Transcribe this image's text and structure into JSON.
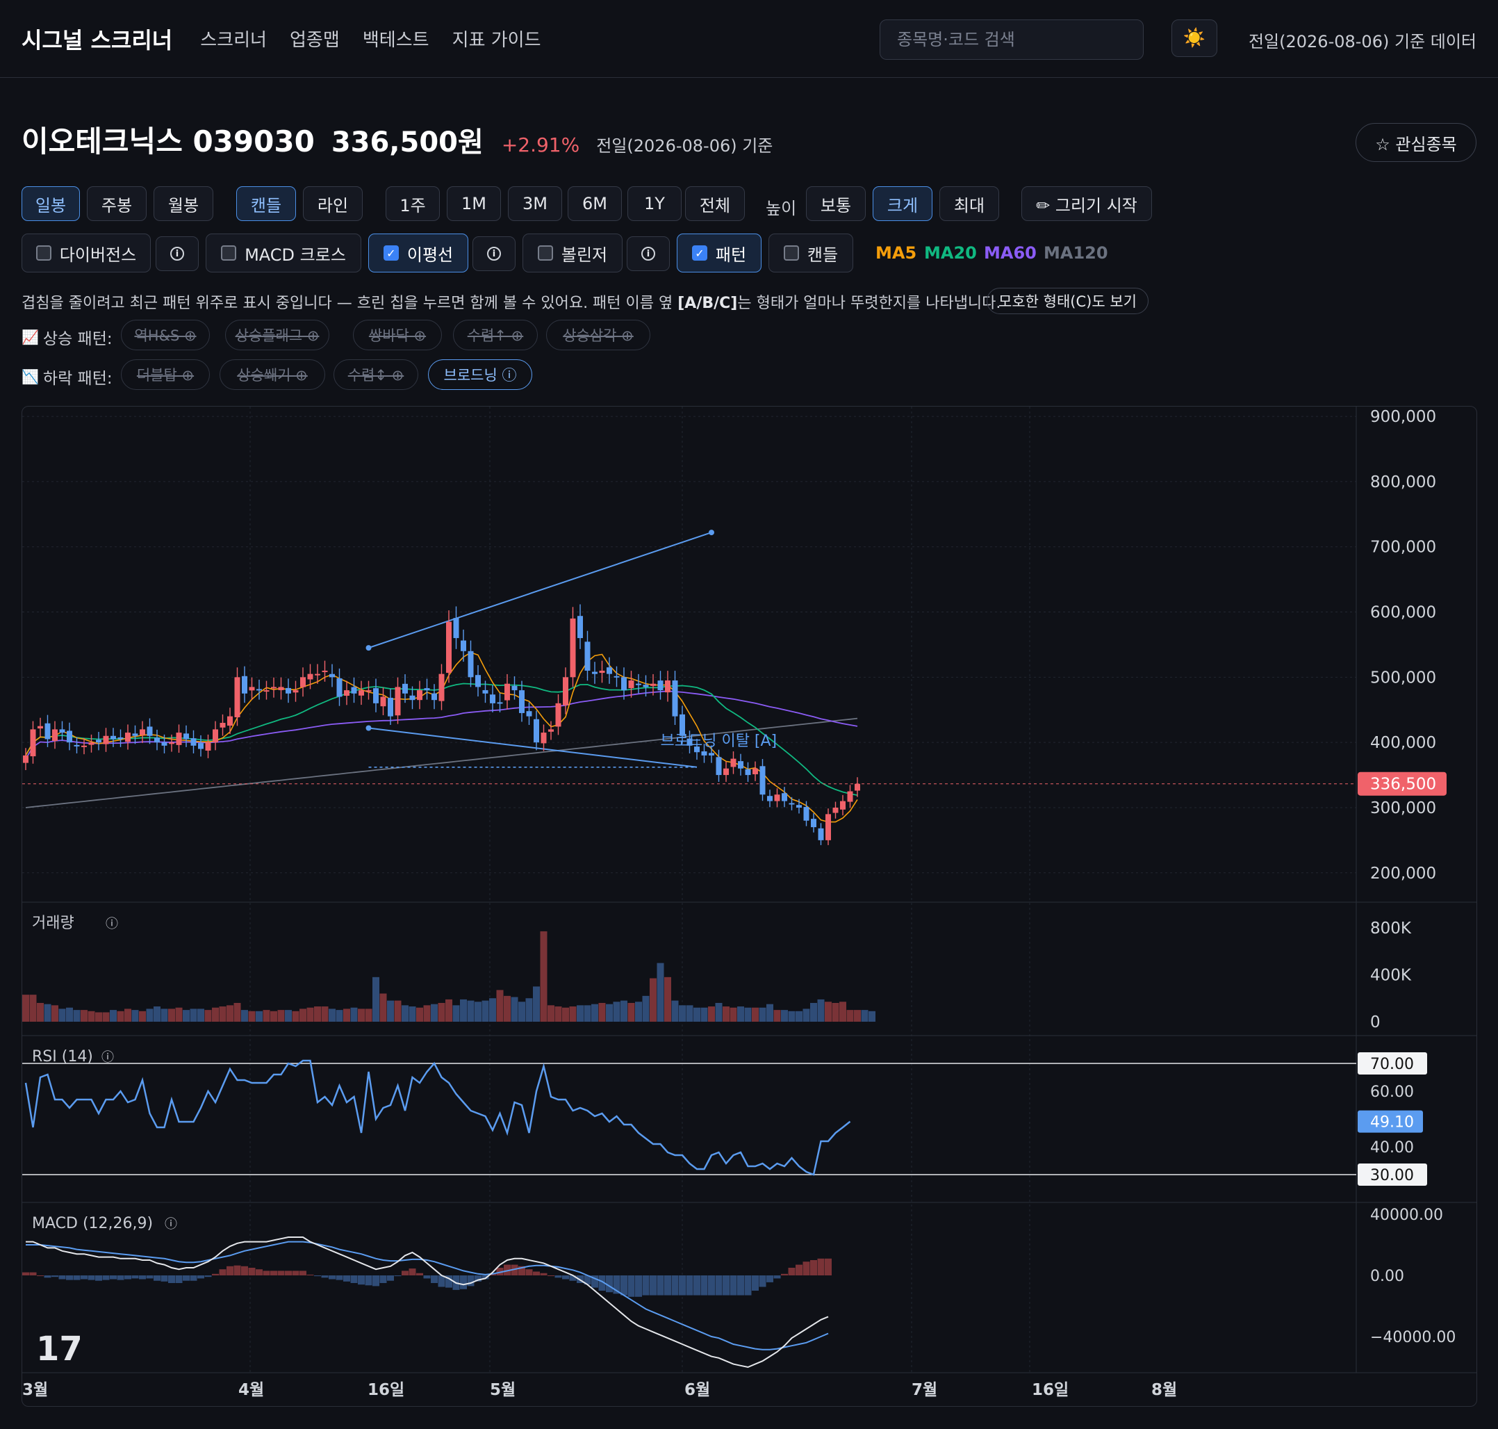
{
  "header": {
    "brand": "시그널 스크리너",
    "nav": [
      "스크리너",
      "업종맵",
      "백테스트",
      "지표 가이드"
    ],
    "search_placeholder": "종목명·코드 검색",
    "theme_icon": "☀️",
    "data_basis": "전일(2026-08-06) 기준 데이터"
  },
  "stock": {
    "name_code": "이오테크닉스 039030",
    "price": "336,500원",
    "change": "+2.91%",
    "basis": "전일(2026-08-06) 기준",
    "watch_label": "☆ 관심종목"
  },
  "controls": {
    "period": [
      "일봉",
      "주봉",
      "월봉"
    ],
    "chart_type": [
      "캔들",
      "라인"
    ],
    "range": [
      "1주",
      "1M",
      "3M",
      "6M",
      "1Y",
      "전체"
    ],
    "height_label": "높이",
    "height": [
      "보통",
      "크게",
      "최대"
    ],
    "draw_label": "✏ 그리기 시작",
    "indicators": {
      "divergence": "다이버전스",
      "macd_cross": "MACD 크로스",
      "ma_lines": "이평선",
      "bollinger": "볼린저",
      "pattern": "패턴",
      "candle": "캔들"
    },
    "ma_legend": [
      {
        "label": "MA5",
        "color": "#f59e0b"
      },
      {
        "label": "MA20",
        "color": "#10b981"
      },
      {
        "label": "MA60",
        "color": "#8b5cf6"
      },
      {
        "label": "MA120",
        "color": "#6b7280"
      }
    ]
  },
  "pattern_note": {
    "text1": "겹침을 줄이려고 최근 패턴 위주로 표시 중입니다 — 흐린 칩을 누르면 함께 볼 수 있어요. 패턴 이름 옆 ",
    "bold": "[A/B/C]",
    "text2": "는 형태가 얼마나 뚜렷한지를 나타냅니다.",
    "ambiguous_btn": "모호한 형태(C)도 보기"
  },
  "patterns": {
    "up_label": "상승 패턴:",
    "up_icon": "📈",
    "up": [
      "역H&S ⊕",
      "상승플래그 ⊕",
      "쌍바닥 ⊕",
      "수렴↑ ⊕",
      "상승삼각 ⊕"
    ],
    "down_label": "하락 패턴:",
    "down_icon": "📉",
    "down": [
      "더블탑 ⊕",
      "상승쐐기 ⊕",
      "수렴↕ ⊕",
      "브로드닝 ⓘ"
    ]
  },
  "chart_data": {
    "type": "candlestick",
    "price_axis": [
      "900,000",
      "800,000",
      "700,000",
      "600,000",
      "500,000",
      "400,000",
      "300,000",
      "200,000"
    ],
    "price_ylim": [
      155000,
      915000
    ],
    "last_price_label": "336,500",
    "last_price": 336500,
    "pattern_annotation": "브로드닝 이탈 [A]",
    "volume_title": "거래량",
    "volume_axis": [
      "800K",
      "400K",
      "0"
    ],
    "rsi_title": "RSI (14)",
    "rsi_axis": [
      "70.00",
      "60.00",
      "49.10",
      "40.00",
      "30.00"
    ],
    "rsi_last": 49.1,
    "macd_title": "MACD (12,26,9)",
    "macd_axis": [
      "40000.00",
      "0.00",
      "−40000.00"
    ],
    "x_labels": [
      "3월",
      "4월",
      "16일",
      "5월",
      "6월",
      "7월",
      "16일",
      "8월"
    ],
    "watermark": "17",
    "closes": [
      380000,
      420000,
      425000,
      405000,
      420000,
      415000,
      400000,
      395000,
      395000,
      400000,
      400000,
      410000,
      405000,
      405000,
      415000,
      410000,
      420000,
      410000,
      400000,
      395000,
      400000,
      415000,
      405000,
      395000,
      390000,
      400000,
      420000,
      430000,
      440000,
      500000,
      475000,
      485000,
      480000,
      480000,
      485000,
      485000,
      475000,
      480000,
      500000,
      505000,
      505000,
      510000,
      500000,
      470000,
      480000,
      475000,
      480000,
      480000,
      460000,
      470000,
      440000,
      485000,
      475000,
      465000,
      480000,
      480000,
      465000,
      505000,
      585000,
      560000,
      540000,
      500000,
      485000,
      475000,
      460000,
      460000,
      490000,
      480000,
      445000,
      440000,
      400000,
      415000,
      420000,
      460000,
      500000,
      590000,
      560000,
      510000,
      505000,
      510000,
      505000,
      500000,
      480000,
      495000,
      490000,
      485000,
      490000,
      480000,
      495000,
      440000,
      410000,
      395000,
      385000,
      380000,
      380000,
      350000,
      360000,
      375000,
      360000,
      350000,
      360000,
      320000,
      310000,
      320000,
      310000,
      305000,
      300000,
      280000,
      270000,
      250000,
      290000,
      300000,
      310000,
      325000,
      336500
    ],
    "volumes": [
      230,
      230,
      160,
      150,
      140,
      110,
      120,
      100,
      100,
      90,
      80,
      80,
      100,
      90,
      110,
      100,
      90,
      110,
      130,
      110,
      110,
      120,
      100,
      110,
      110,
      100,
      120,
      130,
      140,
      160,
      100,
      90,
      90,
      100,
      90,
      100,
      100,
      90,
      110,
      120,
      130,
      130,
      110,
      100,
      110,
      120,
      110,
      110,
      380,
      240,
      180,
      180,
      140,
      130,
      120,
      140,
      150,
      160,
      190,
      140,
      190,
      180,
      170,
      180,
      200,
      270,
      220,
      210,
      170,
      200,
      300,
      770,
      140,
      130,
      120,
      130,
      140,
      140,
      150,
      160,
      150,
      170,
      180,
      160,
      170,
      220,
      370,
      500,
      380,
      180,
      140,
      140,
      120,
      120,
      130,
      160,
      130,
      120,
      130,
      120,
      120,
      120,
      150,
      100,
      100,
      90,
      90,
      110,
      160,
      190,
      170,
      160,
      170,
      100,
      100,
      100,
      90
    ],
    "rsi": [
      63,
      47,
      65,
      66,
      57,
      57,
      54,
      57,
      57,
      57,
      52,
      57,
      57,
      60,
      56,
      57,
      64,
      52,
      47,
      47,
      57,
      49,
      49,
      49,
      54,
      60,
      56,
      62,
      68,
      64,
      64,
      63,
      63,
      63,
      66,
      66,
      70,
      69,
      71,
      71,
      56,
      58,
      55,
      62,
      56,
      58,
      45,
      67,
      50,
      54,
      55,
      62,
      53,
      65,
      63,
      67,
      70,
      65,
      63,
      59,
      56,
      53,
      52,
      51,
      46,
      52,
      45,
      56,
      55,
      45,
      60,
      69,
      58,
      57,
      57,
      53,
      54,
      53,
      51,
      52,
      49,
      51,
      48,
      48,
      45,
      43,
      41,
      41,
      38,
      37,
      37,
      34,
      32,
      32,
      37,
      38,
      34,
      37,
      38,
      33,
      33,
      34,
      32,
      34,
      33,
      36,
      33,
      31,
      30,
      42,
      42,
      45,
      47,
      49.1
    ],
    "macd": [
      22000,
      22000,
      20000,
      18000,
      18000,
      16000,
      15000,
      14000,
      14000,
      13000,
      12000,
      12000,
      12000,
      11000,
      11000,
      11000,
      10000,
      10000,
      8000,
      7000,
      5000,
      4000,
      5000,
      5000,
      7000,
      9000,
      12000,
      16000,
      19000,
      21000,
      22000,
      22000,
      22000,
      22000,
      23000,
      24000,
      25000,
      25000,
      25000,
      22000,
      20000,
      18000,
      16000,
      14000,
      12000,
      10000,
      8000,
      6000,
      4000,
      5000,
      6000,
      9000,
      13000,
      15000,
      12000,
      8000,
      4000,
      0,
      -2000,
      -5000,
      -6000,
      -5000,
      -3000,
      -2000,
      2000,
      7000,
      10000,
      11000,
      11000,
      10000,
      9000,
      8000,
      6000,
      4000,
      2000,
      0,
      -3000,
      -6000,
      -10000,
      -14000,
      -18000,
      -22000,
      -26000,
      -30000,
      -33000,
      -35000,
      -37000,
      -39000,
      -41000,
      -43000,
      -45000,
      -47000,
      -49000,
      -51000,
      -53000,
      -54000,
      -56000,
      -58000,
      -59000,
      -60000,
      -58000,
      -56000,
      -53000,
      -50000,
      -46000,
      -41000,
      -38000,
      -35000,
      -32000,
      -29000,
      -27000
    ],
    "signal": [
      20000,
      20000,
      20000,
      19500,
      19000,
      18500,
      18000,
      17000,
      16500,
      16000,
      15500,
      15000,
      14500,
      14000,
      13500,
      13000,
      12500,
      12000,
      11500,
      11000,
      10000,
      9000,
      8500,
      8500,
      9000,
      10000,
      11000,
      12000,
      13000,
      14500,
      16000,
      17000,
      18000,
      19000,
      20000,
      21000,
      22000,
      22000,
      22000,
      21500,
      20500,
      19500,
      18500,
      17000,
      16000,
      15000,
      14000,
      12500,
      11000,
      10000,
      9500,
      9500,
      10000,
      10500,
      10500,
      10000,
      9000,
      7500,
      6000,
      4500,
      3000,
      2000,
      1000,
      500,
      1000,
      2000,
      3000,
      4000,
      5000,
      6000,
      6500,
      6500,
      6000,
      5500,
      4500,
      3500,
      2000,
      0,
      -2000,
      -4000,
      -7000,
      -10000,
      -13000,
      -16000,
      -19000,
      -22000,
      -24000,
      -26000,
      -28000,
      -30000,
      -32000,
      -34000,
      -36000,
      -38000,
      -40000,
      -41000,
      -43000,
      -45000,
      -46000,
      -47000,
      -48000,
      -48500,
      -48500,
      -48000,
      -47000,
      -46000,
      -45000,
      -44000,
      -42000,
      -40000,
      -38000
    ]
  }
}
